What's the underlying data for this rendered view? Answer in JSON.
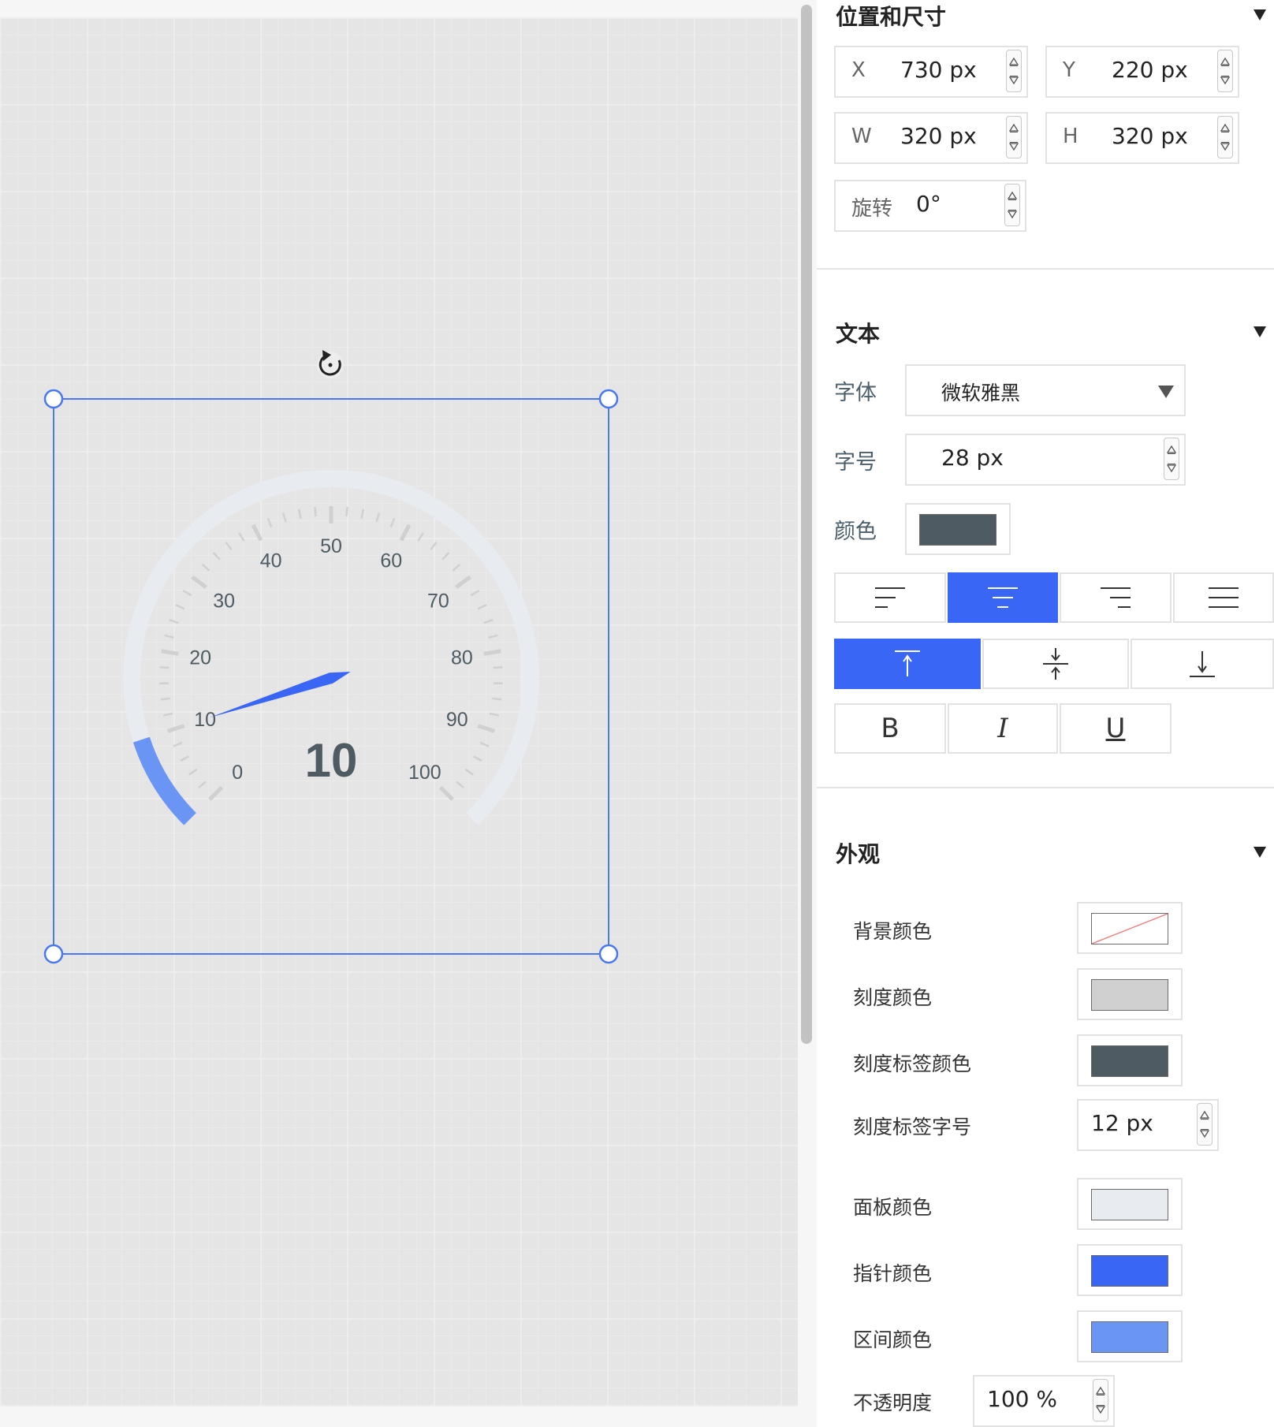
{
  "gauge": {
    "value": "10",
    "reading": 10,
    "min": 0,
    "max": 100,
    "tick_labels": [
      "0",
      "10",
      "20",
      "30",
      "40",
      "50",
      "60",
      "70",
      "80",
      "90",
      "100"
    ]
  },
  "panel": {
    "position_size": {
      "title": "位置和尺寸",
      "x_label": "X",
      "x_value": "730 px",
      "y_label": "Y",
      "y_value": "220 px",
      "w_label": "W",
      "w_value": "320 px",
      "h_label": "H",
      "h_value": "320 px",
      "rotate_label": "旋转",
      "rotate_value": "0°"
    },
    "text": {
      "title": "文本",
      "font_label": "字体",
      "font_value": "微软雅黑",
      "size_label": "字号",
      "size_value": "28 px",
      "color_label": "颜色",
      "color": "#4f5b62",
      "bold": "B",
      "italic": "I",
      "underline": "U"
    },
    "appearance": {
      "title": "外观",
      "bg_color_label": "背景颜色",
      "tick_color_label": "刻度颜色",
      "tick_color": "#d0d0d0",
      "tick_label_color_label": "刻度标签颜色",
      "tick_label_color": "#4f5b62",
      "tick_label_size_label": "刻度标签字号",
      "tick_label_size_value": "12 px",
      "panel_color_label": "面板颜色",
      "panel_color": "#e8ebf0",
      "pointer_color_label": "指针颜色",
      "pointer_color": "#3a66f5",
      "range_color_label": "区间颜色",
      "range_color": "#6b95f5",
      "opacity_label": "不透明度",
      "opacity_value": "100 %"
    }
  },
  "colors": {
    "accent": "#3a66f5",
    "selection": "#4a78f0"
  }
}
